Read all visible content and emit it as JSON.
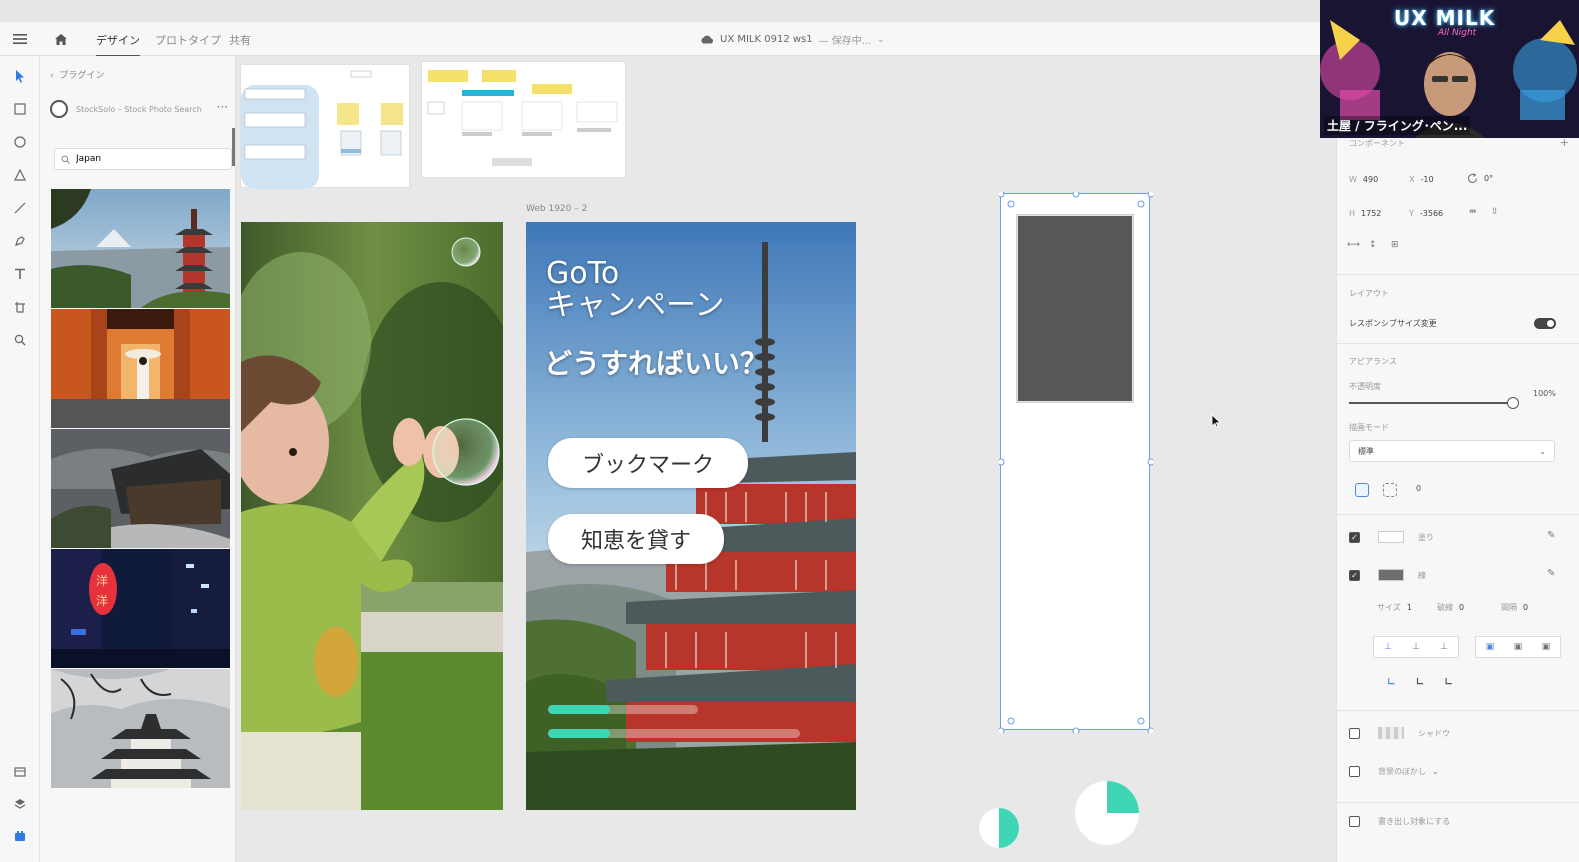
{
  "topbar": {
    "tabs": [
      "デザイン",
      "プロトタイプ",
      "共有"
    ],
    "active_tab": "デザイン",
    "doc_title": "UX MILK 0912 ws1",
    "doc_status": "— 保存中..."
  },
  "plugin_panel": {
    "back_label": "プラグイン",
    "plugin_name": "StockSolo – Stock Photo Search",
    "search_value": "Japan"
  },
  "canvas": {
    "artboard_label": "Web 1920 – 2",
    "mock": {
      "title_line1": "GoTo",
      "title_line2": "キャンペーン",
      "subtitle": "どうすればいい？",
      "button1": "ブックマーク",
      "button2": "知恵を貸す"
    },
    "accent_color": "#3fd6b5",
    "selection_color": "#6a9ee6"
  },
  "webcam": {
    "brand": "UX MILK",
    "subbrand": "All Night",
    "caption": "土屋 / フライング･ペン..."
  },
  "right_panel": {
    "section_component": "コンポーネント",
    "w_label": "W",
    "w_value": "490",
    "x_label": "X",
    "x_value": "-10",
    "rot_value": "0°",
    "h_label": "H",
    "h_value": "1752",
    "y_label": "Y",
    "y_value": "-3566",
    "layout_label": "レイアウト",
    "responsive_label": "レスポンシブサイズ変更",
    "appearance_label": "アピアランス",
    "opacity_label": "不透明度",
    "opacity_value": "100%",
    "opacity_level": 1.0,
    "blend_label": "描画モード",
    "blend_value": "標準",
    "radius_value": "0",
    "fill_label": "塗り",
    "fill_color": "#ffffff",
    "border_label": "線",
    "border_color": "#6e6e6e",
    "size_label": "サイズ",
    "size_value": "1",
    "dash_label": "破線",
    "dash_value": "0",
    "gap_label": "間隔",
    "gap_value": "0",
    "shadow_label": "シャドウ",
    "bgblur_label": "背景のぼかし",
    "export_label": "書き出し対象にする"
  }
}
